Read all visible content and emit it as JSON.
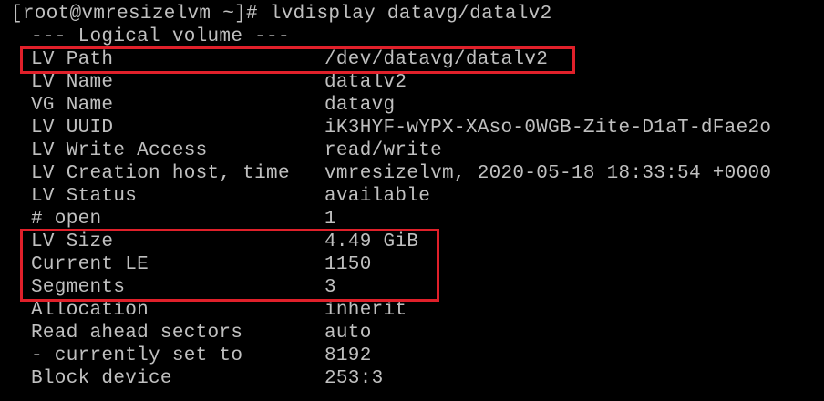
{
  "terminal": {
    "prompt": "[root@vmresizelvm ~]# ",
    "command": "lvdisplay datavg/datalv2",
    "header": "--- Logical volume ---",
    "text_color": "#c0c0c0",
    "background_color": "#000000",
    "highlight_color": "#e0202a",
    "rows": [
      {
        "label": "LV Path",
        "value": "/dev/datavg/datalv2"
      },
      {
        "label": "LV Name",
        "value": "datalv2"
      },
      {
        "label": "VG Name",
        "value": "datavg"
      },
      {
        "label": "LV UUID",
        "value": "iK3HYF-wYPX-XAso-0WGB-Zite-D1aT-dFae2o"
      },
      {
        "label": "LV Write Access",
        "value": "read/write"
      },
      {
        "label": "LV Creation host, time",
        "value": "vmresizelvm, 2020-05-18 18:33:54 +0000"
      },
      {
        "label": "LV Status",
        "value": "available"
      },
      {
        "label": "# open",
        "value": "1"
      },
      {
        "label": "LV Size",
        "value": "4.49 GiB"
      },
      {
        "label": "Current LE",
        "value": "1150"
      },
      {
        "label": "Segments",
        "value": "3"
      },
      {
        "label": "Allocation",
        "value": "inherit"
      },
      {
        "label": "Read ahead sectors",
        "value": "auto"
      },
      {
        "label": "- currently set to",
        "value": "8192"
      },
      {
        "label": "Block device",
        "value": "253:3"
      }
    ]
  }
}
